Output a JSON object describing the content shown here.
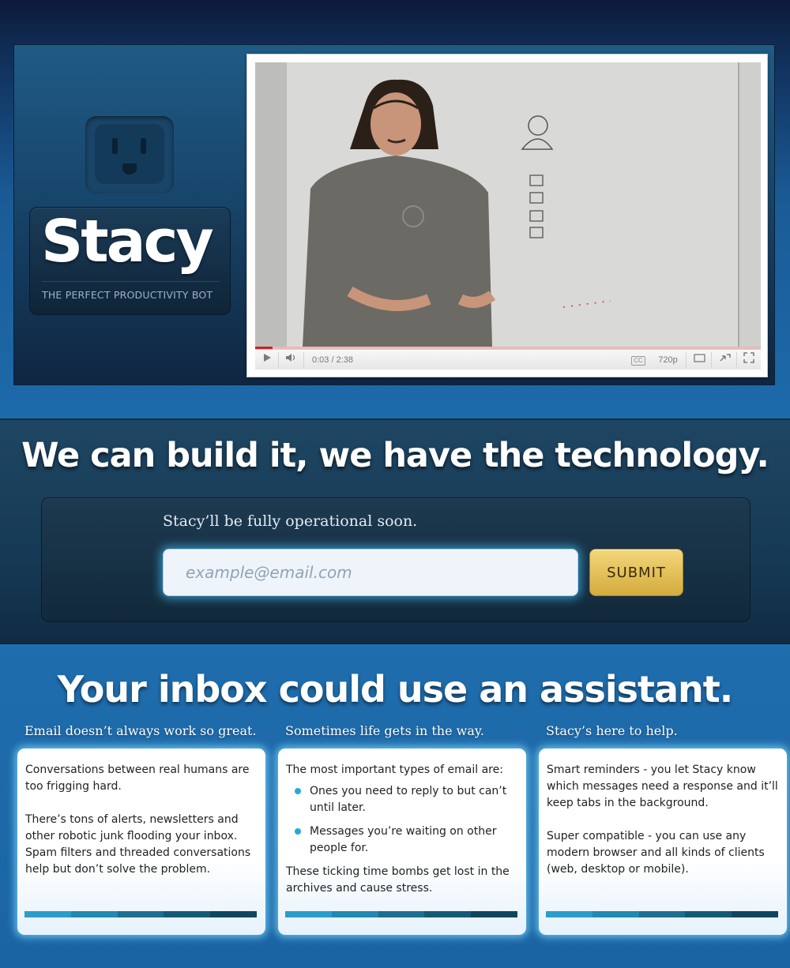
{
  "hero": {
    "logo_title": "Stacy",
    "logo_subtitle": "THE PERFECT PRODUCTIVITY BOT",
    "video": {
      "time_display": "0:03 / 2:38",
      "quality": "720p",
      "cc_label": "CC"
    }
  },
  "signup": {
    "heading": "We can build it, we have the technology.",
    "message": "Stacy’ll be fully operational soon.",
    "email_placeholder": "example@email.com",
    "submit_label": "SUBMIT"
  },
  "features": {
    "heading": "Your inbox could use an assistant.",
    "columns": [
      {
        "title": "Email doesn’t always work so great.",
        "paragraphs": [
          "Conversations between real humans are too frigging hard.",
          "There’s tons of alerts, newsletters and other robotic junk flooding your inbox. Spam filters and threaded conversations help but don’t solve the problem."
        ]
      },
      {
        "title": "Sometimes life gets in the way.",
        "intro": "The most important types of email are:",
        "bullets": [
          "Ones you need to reply to but can’t until later.",
          " Messages you’re waiting on other people for."
        ],
        "outro": "These ticking time bombs get lost in the archives and cause stress."
      },
      {
        "title": "Stacy’s here to help.",
        "paragraphs": [
          "Smart reminders - you let Stacy know which messages need a response and it’ll keep tabs in the background.",
          "Super compatible - you can use any modern browser and all kinds of clients (web, desktop or mobile)."
        ]
      }
    ]
  },
  "colors": {
    "accent_glow": "#4ac4ff",
    "submit_gold": "#e2bd55",
    "bullet_blue": "#27a8d6",
    "progress_red": "#d61e1e"
  },
  "icons": [
    "socket-icon",
    "play-icon",
    "volume-icon",
    "cc-icon",
    "popout-icon",
    "expand-icon",
    "fullscreen-icon"
  ]
}
